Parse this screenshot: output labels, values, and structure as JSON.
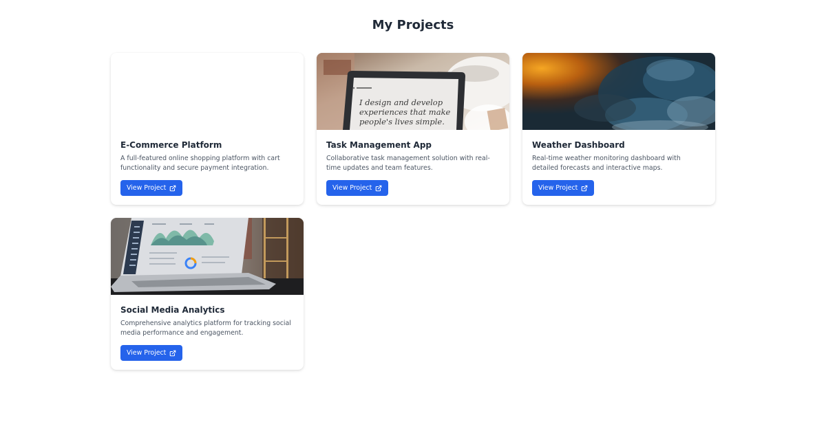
{
  "page": {
    "title": "My Projects"
  },
  "projects": [
    {
      "title": "E-Commerce Platform",
      "description": "A full-featured online shopping platform with cart functionality and secure payment integration.",
      "button_label": "View Project",
      "image": "none"
    },
    {
      "title": "Task Management App",
      "description": "Collaborative task management solution with real-time updates and team features.",
      "button_label": "View Project",
      "image": "laptop-photo",
      "image_text": [
        "I design and develop",
        "experiences that make",
        "people's lives simple."
      ]
    },
    {
      "title": "Weather Dashboard",
      "description": "Real-time weather monitoring dashboard with detailed forecasts and interactive maps.",
      "button_label": "View Project",
      "image": "storm-clouds-photo"
    },
    {
      "title": "Social Media Analytics",
      "description": "Comprehensive analytics platform for tracking social media performance and engagement.",
      "button_label": "View Project",
      "image": "analytics-laptop-photo"
    }
  ],
  "colors": {
    "accent": "#2563eb",
    "title": "#1f2937",
    "text": "#4b5563"
  },
  "icons": {
    "button": "external-link-icon"
  }
}
